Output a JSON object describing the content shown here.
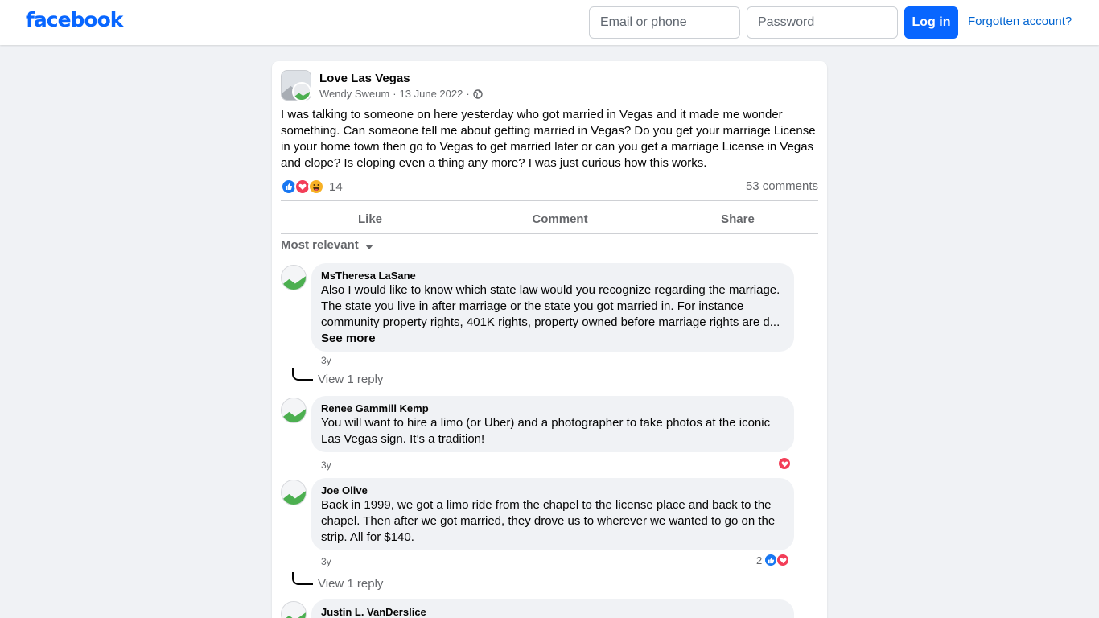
{
  "header": {
    "logo": "facebook",
    "email_placeholder": "Email or phone",
    "password_placeholder": "Password",
    "login_label": "Log in",
    "forgot_label": "Forgotten account?"
  },
  "post": {
    "group_name": "Love Las Vegas",
    "author": "Wendy Sweum",
    "date": "13 June 2022",
    "separator": "·",
    "text": "I was talking to someone on here yesterday who got married in Vegas and it made me wonder something.  Can someone tell me about getting married in Vegas? Do you get your marriage License in your home town then go to Vegas to get married later or can you get a marriage License in Vegas and elope? Is eloping even a thing any more? I was just curious how this works.",
    "reaction_count": "14",
    "comments_count": "53 comments",
    "actions": {
      "like": "Like",
      "comment": "Comment",
      "share": "Share"
    },
    "sort_label": "Most relevant"
  },
  "comments": [
    {
      "name": "MsTheresa LaSane",
      "text": "Also I would like to know which state law would you recognize regarding the marriage. The state you live in after marriage or the state you got married in. For instance community property rights, 401K rights, property owned before marriage rights are d...",
      "see_more": "See more",
      "age": "3y",
      "view_reply": "View 1 reply"
    },
    {
      "name": "Renee Gammill Kemp",
      "text": "You will want to hire a limo (or Uber) and a photographer to take photos at the iconic Las Vegas sign. It’s a tradition!",
      "age": "3y"
    },
    {
      "name": "Joe Olive",
      "text": "Back in 1999, we got a limo ride from the chapel to the license place and back to the chapel. Then after we got married, they drove us to wherever we wanted to go on the strip. All for $140.",
      "age": "3y",
      "reaction_count": "2",
      "view_reply": "View 1 reply"
    },
    {
      "name": "Justin L. VanDerslice"
    }
  ],
  "colors": {
    "brand": "#0866ff",
    "like": "#1877f2",
    "love": "#f33e58",
    "haha": "#f7b125"
  }
}
